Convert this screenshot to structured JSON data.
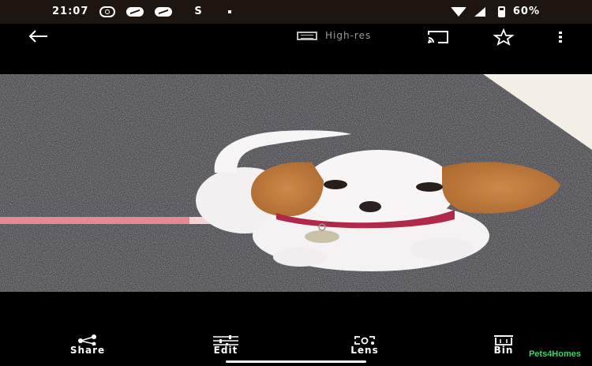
{
  "status_bar": {
    "time": "21:07",
    "carrier_letter": "S",
    "battery": "60%"
  },
  "toolbar": {
    "back_icon": "arrow-left-icon",
    "quality_label": "High-res",
    "cast_icon": "cast-icon",
    "favorite_icon": "star-outline-icon",
    "more_icon": "more-vert-icon"
  },
  "photo": {
    "description_icon": "photo-image"
  },
  "actions": [
    {
      "label": "Share",
      "icon": "share-icon"
    },
    {
      "label": "Edit",
      "icon": "sliders-icon"
    },
    {
      "label": "Lens",
      "icon": "lens-icon"
    },
    {
      "label": "Bin",
      "icon": "trash-icon"
    }
  ],
  "watermark": "Pets4Homes",
  "colors": {
    "background": "#000000",
    "status_bar": "#1c1510",
    "watermark": "#3ad36a"
  }
}
